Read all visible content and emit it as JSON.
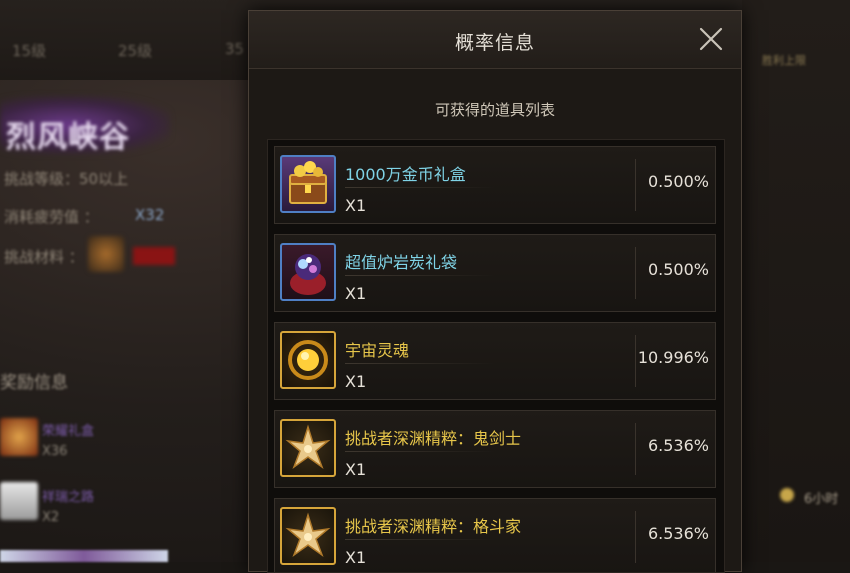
{
  "background": {
    "tabs": [
      "15级",
      "25级",
      "35"
    ],
    "dungeon_name": "烈风峡谷",
    "requirement_lines": [
      "挑战等级：50以上",
      "消耗疲劳值 ：",
      "挑战材料 ："
    ],
    "fatigue_cost": "X32",
    "section_title": "奖励信息",
    "rewards": [
      {
        "name": "荣耀礼盒",
        "count": "X36"
      },
      {
        "name": "祥瑞之路",
        "count": "X2"
      }
    ],
    "right_label": "胜利上限",
    "right_timer": "6小时"
  },
  "dialog": {
    "title": "概率信息",
    "subtitle": "可获得的道具列表",
    "items": [
      {
        "name": "1000万金币礼盒",
        "count": "X1",
        "rate": "0.500%",
        "name_color": "#7fd3e6",
        "icon": "gold-chest-icon"
      },
      {
        "name": "超值炉岩炭礼袋",
        "count": "X1",
        "rate": "0.500%",
        "name_color": "#7fd3e6",
        "icon": "gem-pouch-icon"
      },
      {
        "name": "宇宙灵魂",
        "count": "X1",
        "rate": "10.996%",
        "name_color": "#e7c64a",
        "icon": "cosmic-soul-icon"
      },
      {
        "name": "挑战者深渊精粹：鬼剑士",
        "count": "X1",
        "rate": "6.536%",
        "name_color": "#e7c64a",
        "icon": "abyss-essence-icon"
      },
      {
        "name": "挑战者深渊精粹：格斗家",
        "count": "X1",
        "rate": "6.536%",
        "name_color": "#e7c64a",
        "icon": "abyss-essence-icon"
      }
    ]
  }
}
